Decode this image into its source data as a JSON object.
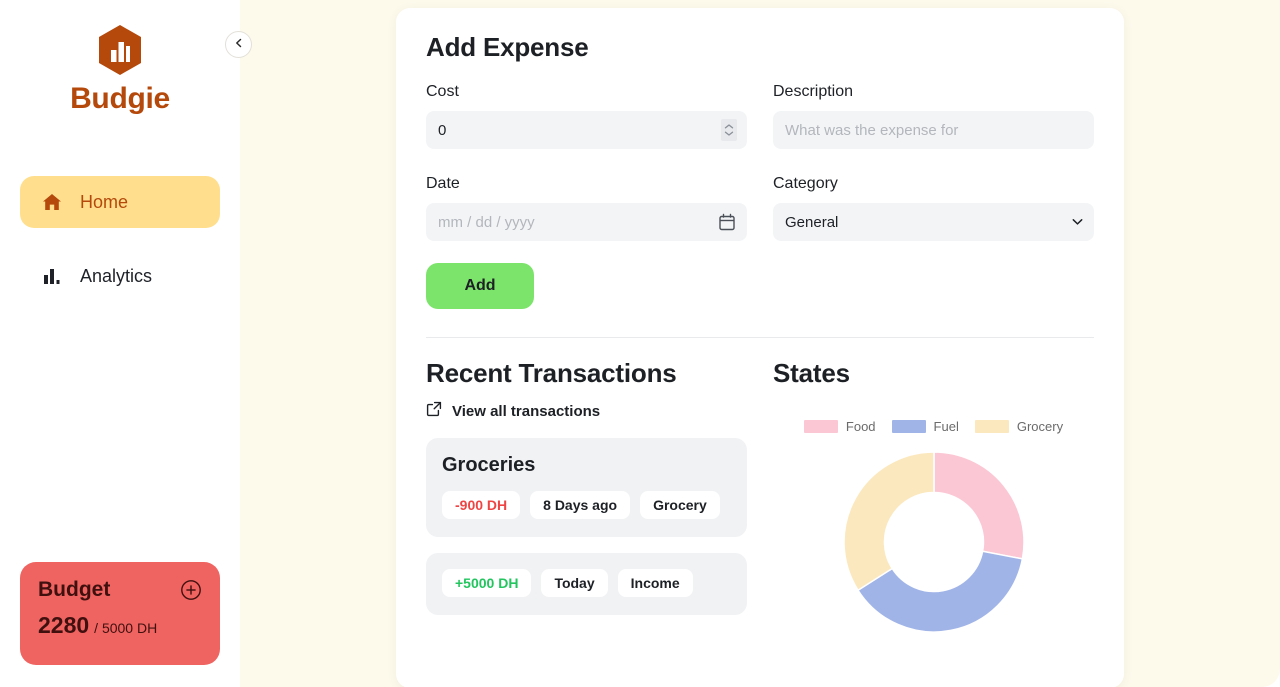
{
  "sidebar": {
    "brand": {
      "name": "Budgie",
      "logo_icon": "hexagon-bar-chart-logo"
    },
    "collapse_icon": "chevron-left-icon",
    "items": [
      {
        "label": "Home",
        "icon": "home-icon",
        "active": true
      },
      {
        "label": "Analytics",
        "icon": "bar-chart-icon",
        "active": false
      }
    ],
    "budget": {
      "title": "Budget",
      "add_icon": "plus-circle-icon",
      "spent": "2280",
      "total": "/ 5000 DH"
    }
  },
  "form": {
    "title": "Add Expense",
    "cost": {
      "label": "Cost",
      "value": "0",
      "spinner_icon": "number-spinner-icon"
    },
    "description": {
      "label": "Description",
      "value": "",
      "placeholder": "What was the expense for"
    },
    "date": {
      "label": "Date",
      "value": "",
      "placeholder": "mm / dd / yyyy",
      "icon": "calendar-icon"
    },
    "category": {
      "label": "Category",
      "selected": "General",
      "caret_icon": "chevron-down-icon",
      "options": [
        "General"
      ]
    },
    "submit_label": "Add"
  },
  "transactions": {
    "title": "Recent Transactions",
    "view_all_label": "View all transactions",
    "view_all_icon": "external-link-icon",
    "items": [
      {
        "name": "Groceries",
        "amount": "-900 DH",
        "amount_sign": "neg",
        "date": "8 Days ago",
        "category": "Grocery"
      },
      {
        "name": "",
        "amount": "+5000 DH",
        "amount_sign": "pos",
        "date": "Today",
        "category": "Income"
      }
    ]
  },
  "states": {
    "title": "States"
  },
  "chart_data": {
    "type": "pie",
    "title": "States",
    "variant": "donut",
    "legend_position": "top",
    "labels": [
      "Food",
      "Fuel",
      "Grocery"
    ],
    "values": [
      28,
      38,
      34
    ],
    "colors": [
      "#fbc7d4",
      "#a0b4e8",
      "#fce8be"
    ],
    "start_angle": 0,
    "inner_radius_ratio": 0.55
  },
  "colors": {
    "brand": "#b4490b",
    "nav_active_bg": "#ffdf8e",
    "budget_bg": "#ef6461",
    "add_button": "#7ce46a",
    "page_bg": "#fdfaec",
    "negative": "#ef4444",
    "positive": "#22c55e"
  }
}
